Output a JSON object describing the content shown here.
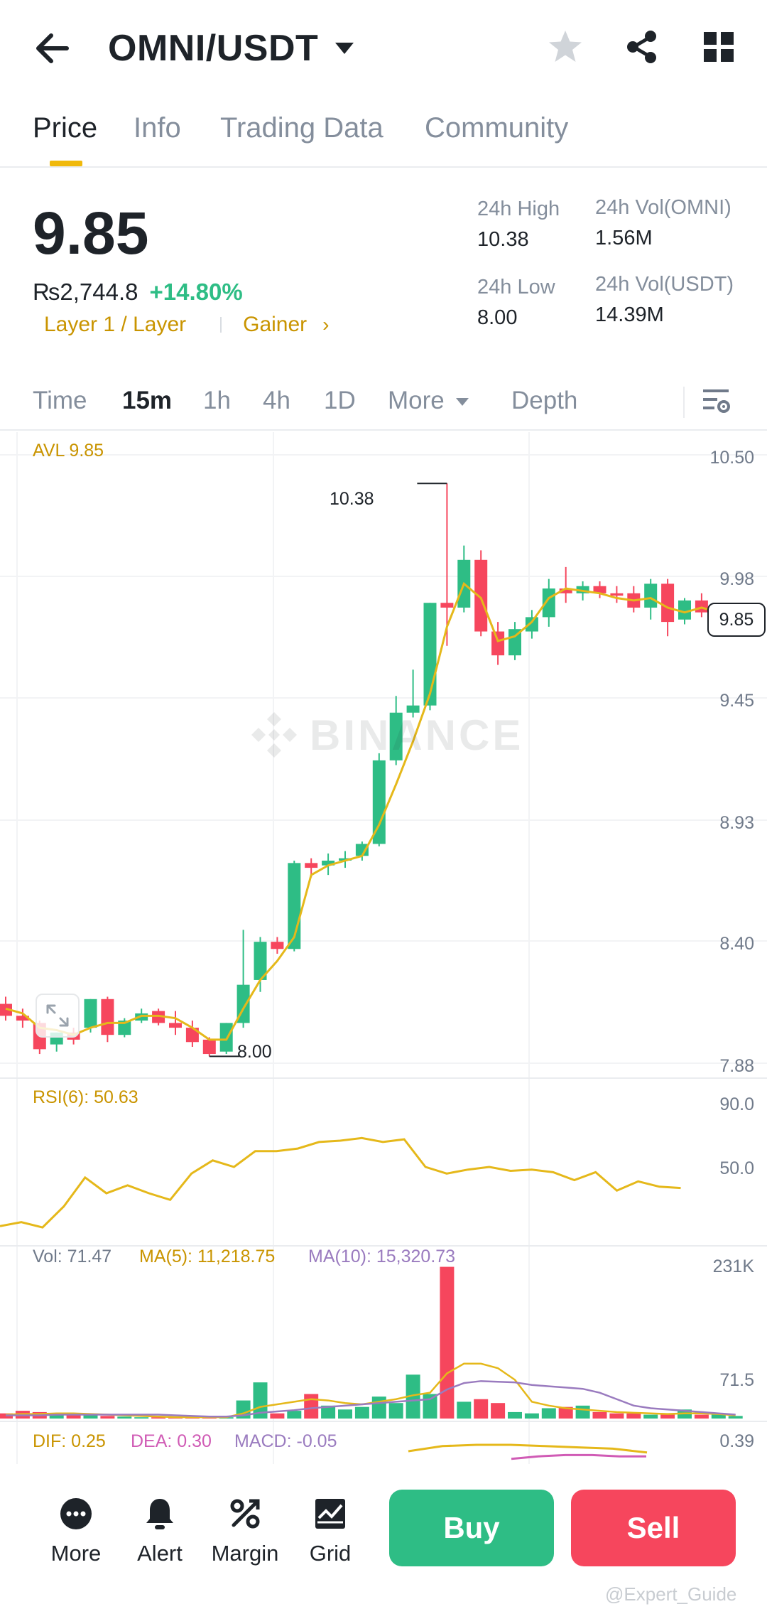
{
  "header": {
    "pair": "OMNI/USDT"
  },
  "tabs": [
    {
      "label": "Price",
      "active": true
    },
    {
      "label": "Info",
      "active": false
    },
    {
      "label": "Trading Data",
      "active": false
    },
    {
      "label": "Community",
      "active": false
    }
  ],
  "price": {
    "last": "9.85",
    "inr": "₨2,744.8",
    "change": "+14.80%",
    "tag_category": "Layer 1 / Layer",
    "tag_rank": "Gainer",
    "high_label": "24h High",
    "high_value": "10.38",
    "low_label": "24h Low",
    "low_value": "8.00",
    "vol_base_label": "24h Vol(OMNI)",
    "vol_base_value": "1.56M",
    "vol_quote_label": "24h Vol(USDT)",
    "vol_quote_value": "14.39M"
  },
  "intervals": {
    "time": "Time",
    "m15": "15m",
    "h1": "1h",
    "h4": "4h",
    "d1": "1D",
    "more": "More",
    "depth": "Depth"
  },
  "chart_labels": {
    "avl": "AVL 9.85",
    "watermark": "BINANCE",
    "price_axis": [
      "10.50",
      "9.98",
      "9.45",
      "8.93",
      "8.40",
      "7.88"
    ],
    "high_marker": "10.38",
    "low_marker": "8.00",
    "current_price": "9.85",
    "rsi_label": "RSI(6): 50.63",
    "rsi_axis": [
      "90.0",
      "50.0"
    ],
    "vol_label": "Vol: 71.47",
    "ma5_label": "MA(5): 11,218.75",
    "ma10_label": "MA(10): 15,320.73",
    "vol_axis": [
      "231K",
      "71.5"
    ],
    "dif_label": "DIF: 0.25",
    "dea_label": "DEA: 0.30",
    "macd_label": "MACD: -0.05",
    "macd_axis": "0.39"
  },
  "chart_data": {
    "type": "candlestick",
    "y_range": [
      7.88,
      10.5
    ],
    "colors": {
      "up": "#2ebd85",
      "down": "#f6465d",
      "ma": "#e5b81a",
      "ma10": "#9a7bbf",
      "dea": "#d05bb5"
    },
    "candles": [
      {
        "o": 8.2,
        "h": 8.23,
        "c": 8.15,
        "l": 8.13
      },
      {
        "o": 8.15,
        "h": 8.18,
        "c": 8.13,
        "l": 8.1
      },
      {
        "o": 8.12,
        "h": 8.13,
        "c": 8.01,
        "l": 7.99
      },
      {
        "o": 8.03,
        "h": 8.08,
        "c": 8.08,
        "l": 8.0
      },
      {
        "o": 8.08,
        "h": 8.1,
        "c": 8.05,
        "l": 8.03
      },
      {
        "o": 8.1,
        "h": 8.22,
        "c": 8.22,
        "l": 8.08
      },
      {
        "o": 8.22,
        "h": 8.23,
        "c": 8.07,
        "l": 8.04
      },
      {
        "o": 8.07,
        "h": 8.14,
        "c": 8.13,
        "l": 8.06
      },
      {
        "o": 8.13,
        "h": 8.18,
        "c": 8.16,
        "l": 8.12
      },
      {
        "o": 8.17,
        "h": 8.18,
        "c": 8.12,
        "l": 8.11
      },
      {
        "o": 8.12,
        "h": 8.17,
        "c": 8.1,
        "l": 8.07
      },
      {
        "o": 8.1,
        "h": 8.13,
        "c": 8.04,
        "l": 8.02
      },
      {
        "o": 8.05,
        "h": 8.06,
        "c": 7.99,
        "l": 7.98
      },
      {
        "o": 8.0,
        "h": 8.12,
        "c": 8.12,
        "l": 7.99
      },
      {
        "o": 8.12,
        "h": 8.51,
        "c": 8.28,
        "l": 8.1
      },
      {
        "o": 8.3,
        "h": 8.48,
        "c": 8.46,
        "l": 8.25
      },
      {
        "o": 8.46,
        "h": 8.48,
        "c": 8.43,
        "l": 8.41
      },
      {
        "o": 8.43,
        "h": 8.8,
        "c": 8.79,
        "l": 8.42
      },
      {
        "o": 8.79,
        "h": 8.81,
        "c": 8.77,
        "l": 8.73
      },
      {
        "o": 8.78,
        "h": 8.83,
        "c": 8.8,
        "l": 8.74
      },
      {
        "o": 8.8,
        "h": 8.84,
        "c": 8.81,
        "l": 8.77
      },
      {
        "o": 8.82,
        "h": 8.88,
        "c": 8.87,
        "l": 8.8
      },
      {
        "o": 8.87,
        "h": 9.25,
        "c": 9.22,
        "l": 8.86
      },
      {
        "o": 9.22,
        "h": 9.49,
        "c": 9.42,
        "l": 9.2
      },
      {
        "o": 9.42,
        "h": 9.6,
        "c": 9.45,
        "l": 9.4
      },
      {
        "o": 9.45,
        "h": 9.88,
        "c": 9.88,
        "l": 9.43
      },
      {
        "o": 9.88,
        "h": 10.38,
        "c": 9.86,
        "l": 9.7
      },
      {
        "o": 9.86,
        "h": 10.12,
        "c": 10.06,
        "l": 9.84
      },
      {
        "o": 10.06,
        "h": 10.1,
        "c": 9.76,
        "l": 9.74
      },
      {
        "o": 9.76,
        "h": 9.8,
        "c": 9.66,
        "l": 9.62
      },
      {
        "o": 9.66,
        "h": 9.8,
        "c": 9.77,
        "l": 9.64
      },
      {
        "o": 9.76,
        "h": 9.85,
        "c": 9.82,
        "l": 9.73
      },
      {
        "o": 9.82,
        "h": 9.98,
        "c": 9.94,
        "l": 9.78
      },
      {
        "o": 9.94,
        "h": 10.03,
        "c": 9.92,
        "l": 9.88
      },
      {
        "o": 9.92,
        "h": 9.97,
        "c": 9.95,
        "l": 9.89
      },
      {
        "o": 9.95,
        "h": 9.97,
        "c": 9.92,
        "l": 9.9
      },
      {
        "o": 9.92,
        "h": 9.95,
        "c": 9.91,
        "l": 9.88
      },
      {
        "o": 9.92,
        "h": 9.95,
        "c": 9.86,
        "l": 9.84
      },
      {
        "o": 9.86,
        "h": 9.98,
        "c": 9.96,
        "l": 9.81
      },
      {
        "o": 9.96,
        "h": 9.98,
        "c": 9.8,
        "l": 9.74
      },
      {
        "o": 9.81,
        "h": 9.9,
        "c": 9.89,
        "l": 9.79
      },
      {
        "o": 9.89,
        "h": 9.92,
        "c": 9.84,
        "l": 9.82
      },
      {
        "o": 9.84,
        "h": 9.86,
        "c": 9.84,
        "l": 9.81
      },
      {
        "o": 9.84,
        "h": 9.86,
        "c": 9.85,
        "l": 9.83
      }
    ],
    "ma_line": [
      8.18,
      8.16,
      8.1,
      8.09,
      8.07,
      8.1,
      8.12,
      8.12,
      8.15,
      8.15,
      8.14,
      8.1,
      8.05,
      8.05,
      8.18,
      8.3,
      8.38,
      8.48,
      8.74,
      8.78,
      8.8,
      8.82,
      8.95,
      9.12,
      9.3,
      9.5,
      9.78,
      9.96,
      9.9,
      9.72,
      9.74,
      9.8,
      9.9,
      9.94,
      9.93,
      9.92,
      9.9,
      9.89,
      9.9,
      9.86,
      9.84,
      9.86,
      9.84,
      9.85
    ],
    "rsi": [
      15,
      18,
      14,
      30,
      52,
      40,
      46,
      40,
      35,
      55,
      65,
      60,
      72,
      72,
      74,
      79,
      80,
      82,
      79,
      81,
      60,
      55,
      58,
      60,
      57,
      58,
      56,
      50,
      56,
      42,
      49,
      45,
      44
    ],
    "rsi_range": [
      0,
      100
    ],
    "volume": [
      8,
      12,
      10,
      8,
      8,
      6,
      4,
      3,
      2,
      2,
      2,
      2,
      3,
      2,
      28,
      56,
      8,
      12,
      38,
      20,
      14,
      18,
      34,
      24,
      68,
      38,
      235,
      26,
      30,
      24,
      10,
      8,
      16,
      18,
      20,
      10,
      8,
      8,
      6,
      6,
      14,
      6,
      6,
      4
    ],
    "vol_ma5": [
      6,
      7,
      7,
      8,
      8,
      7,
      6,
      5,
      4,
      3,
      2,
      2,
      2,
      2,
      8,
      18,
      22,
      26,
      30,
      28,
      24,
      22,
      26,
      30,
      36,
      40,
      70,
      85,
      85,
      78,
      60,
      26,
      20,
      16,
      14,
      12,
      10,
      9,
      8,
      7,
      8,
      8,
      7,
      5
    ],
    "vol_ma10": [
      5,
      5,
      5,
      6,
      6,
      6,
      6,
      6,
      6,
      6,
      5,
      4,
      3,
      3,
      5,
      9,
      11,
      13,
      16,
      18,
      20,
      22,
      24,
      26,
      28,
      30,
      45,
      55,
      58,
      57,
      56,
      52,
      50,
      48,
      46,
      40,
      30,
      20,
      16,
      14,
      12,
      10,
      8,
      6
    ],
    "vol_range": [
      0,
      240
    ],
    "macd_dif": [
      0.34,
      0.38,
      0.39,
      0.39,
      0.38,
      0.37,
      0.36,
      0.33
    ],
    "macd_dea": [
      0.28,
      0.3,
      0.31,
      0.31,
      0.3,
      0.3
    ]
  },
  "bottom_bar": {
    "more": "More",
    "alert": "Alert",
    "margin": "Margin",
    "grid": "Grid",
    "buy": "Buy",
    "sell": "Sell",
    "watermark": "@Expert_Guide"
  }
}
